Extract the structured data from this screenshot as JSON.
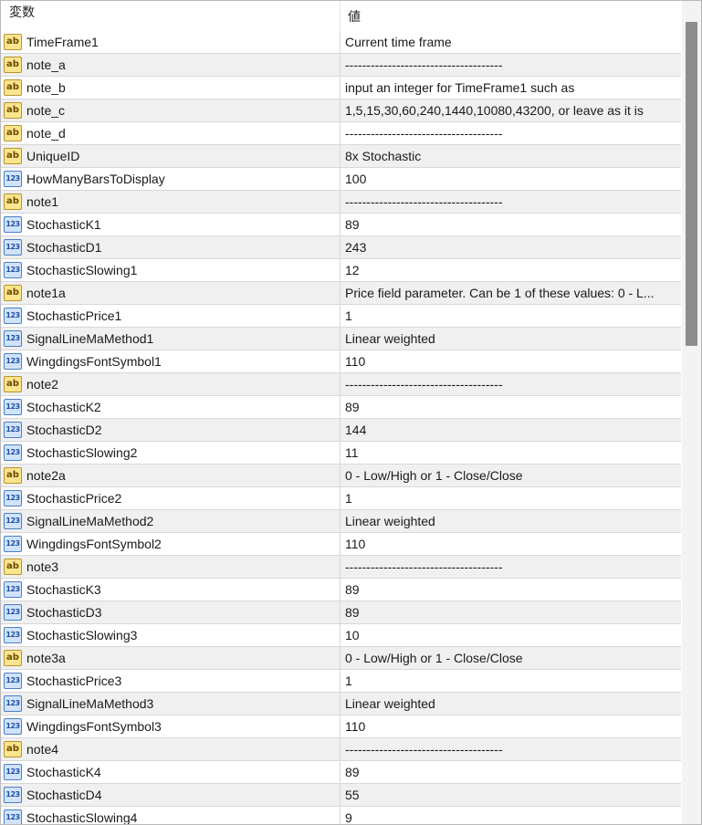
{
  "header": {
    "name_label": "変数",
    "value_label": "値"
  },
  "rows": [
    {
      "type": "str",
      "name": "TimeFrame1",
      "value": "Current time frame"
    },
    {
      "type": "str",
      "name": "note_a",
      "value": "-------------------------------------"
    },
    {
      "type": "str",
      "name": "note_b",
      "value": "input an integer for TimeFrame1 such as"
    },
    {
      "type": "str",
      "name": "note_c",
      "value": "1,5,15,30,60,240,1440,10080,43200, or leave as it is"
    },
    {
      "type": "str",
      "name": "note_d",
      "value": "-------------------------------------"
    },
    {
      "type": "str",
      "name": "UniqueID",
      "value": "8x Stochastic"
    },
    {
      "type": "num",
      "name": "HowManyBarsToDisplay",
      "value": "100"
    },
    {
      "type": "str",
      "name": "note1",
      "value": "-------------------------------------"
    },
    {
      "type": "num",
      "name": "StochasticK1",
      "value": "89"
    },
    {
      "type": "num",
      "name": "StochasticD1",
      "value": "243"
    },
    {
      "type": "num",
      "name": "StochasticSlowing1",
      "value": "12"
    },
    {
      "type": "str",
      "name": "note1a",
      "value": "Price field parameter. Can be 1 of these values: 0 - L..."
    },
    {
      "type": "num",
      "name": "StochasticPrice1",
      "value": "1"
    },
    {
      "type": "num",
      "name": "SignalLineMaMethod1",
      "value": "Linear weighted"
    },
    {
      "type": "num",
      "name": "WingdingsFontSymbol1",
      "value": "110"
    },
    {
      "type": "str",
      "name": "note2",
      "value": "-------------------------------------"
    },
    {
      "type": "num",
      "name": "StochasticK2",
      "value": "89"
    },
    {
      "type": "num",
      "name": "StochasticD2",
      "value": "144"
    },
    {
      "type": "num",
      "name": "StochasticSlowing2",
      "value": "11"
    },
    {
      "type": "str",
      "name": "note2a",
      "value": "0 - Low/High or 1 - Close/Close"
    },
    {
      "type": "num",
      "name": "StochasticPrice2",
      "value": "1"
    },
    {
      "type": "num",
      "name": "SignalLineMaMethod2",
      "value": "Linear weighted"
    },
    {
      "type": "num",
      "name": "WingdingsFontSymbol2",
      "value": "110"
    },
    {
      "type": "str",
      "name": "note3",
      "value": "-------------------------------------"
    },
    {
      "type": "num",
      "name": "StochasticK3",
      "value": "89"
    },
    {
      "type": "num",
      "name": "StochasticD3",
      "value": "89"
    },
    {
      "type": "num",
      "name": "StochasticSlowing3",
      "value": "10"
    },
    {
      "type": "str",
      "name": "note3a",
      "value": "0 - Low/High or 1 - Close/Close"
    },
    {
      "type": "num",
      "name": "StochasticPrice3",
      "value": "1"
    },
    {
      "type": "num",
      "name": "SignalLineMaMethod3",
      "value": "Linear weighted"
    },
    {
      "type": "num",
      "name": "WingdingsFontSymbol3",
      "value": "110"
    },
    {
      "type": "str",
      "name": "note4",
      "value": "-------------------------------------"
    },
    {
      "type": "num",
      "name": "StochasticK4",
      "value": "89"
    },
    {
      "type": "num",
      "name": "StochasticD4",
      "value": "55"
    },
    {
      "type": "num",
      "name": "StochasticSlowing4",
      "value": "9"
    }
  ],
  "icons": {
    "str": {
      "name": "string-type-icon",
      "text": "ab"
    },
    "num": {
      "name": "integer-type-icon",
      "text": "123"
    }
  }
}
